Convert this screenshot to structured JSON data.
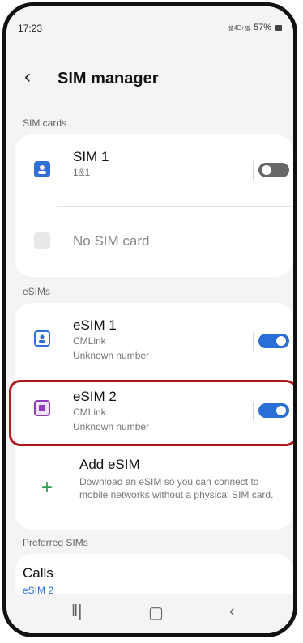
{
  "status_bar": {
    "time": "17:23",
    "signal_text": "᯾ 4G+ ᯾",
    "battery": "57%"
  },
  "header": {
    "back_icon": "chevron-left-icon",
    "title": "SIM manager"
  },
  "sim_cards": {
    "section_label": "SIM cards",
    "sim1": {
      "name": "SIM 1",
      "carrier": "1&1",
      "toggle_on": false
    },
    "no_sim": {
      "label": "No SIM card"
    }
  },
  "esims": {
    "section_label": "eSIMs",
    "esim1": {
      "name": "eSIM 1",
      "carrier": "CMLink",
      "number": "Unknown number",
      "toggle_on": true
    },
    "esim2": {
      "name": "eSIM 2",
      "carrier": "CMLink",
      "number": "Unknown number",
      "toggle_on": true
    },
    "add": {
      "title": "Add eSIM",
      "description": "Download an eSIM so you can connect to mobile networks without a physical SIM card."
    }
  },
  "preferred": {
    "section_label": "Preferred SIMs",
    "calls_label": "Calls",
    "calls_value": "eSIM 2"
  },
  "colors": {
    "accent": "#2a6fd8",
    "highlight": "#b11a1a",
    "plus": "#2e9c55",
    "esim2_icon": "#8e3fb7",
    "sim1_icon": "#2f6fd6"
  },
  "navbar": {
    "recents_icon": "recents-icon",
    "home_icon": "home-icon",
    "back_icon": "back-icon"
  }
}
